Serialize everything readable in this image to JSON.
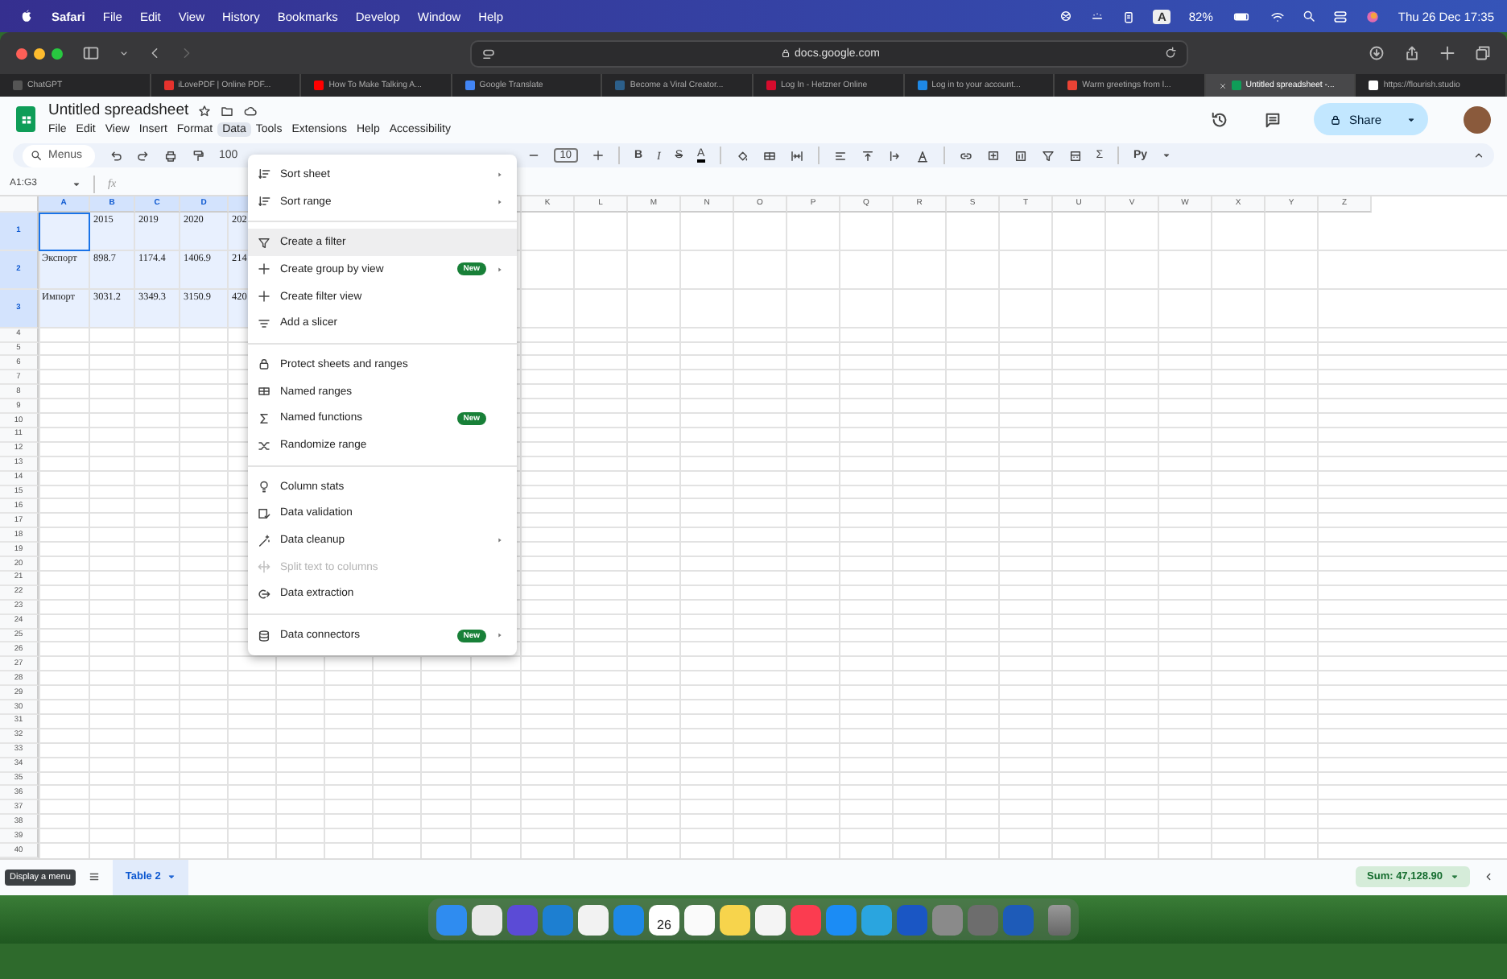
{
  "menubar": {
    "app": "Safari",
    "items": [
      "File",
      "Edit",
      "View",
      "History",
      "Bookmarks",
      "Develop",
      "Window",
      "Help"
    ],
    "input_source": "A",
    "battery": "82%",
    "clock": "Thu 26 Dec  17:35"
  },
  "browser": {
    "address": "docs.google.com",
    "tabs": [
      {
        "title": "ChatGPT",
        "selected": false
      },
      {
        "title": "iLovePDF | Online PDF...",
        "selected": false
      },
      {
        "title": "How To Make Talking A...",
        "selected": false
      },
      {
        "title": "Google Translate",
        "selected": false
      },
      {
        "title": "Become a Viral Creator...",
        "selected": false
      },
      {
        "title": "Log In - Hetzner Online",
        "selected": false
      },
      {
        "title": "Log in to your account...",
        "selected": false
      },
      {
        "title": "Warm greetings from l...",
        "selected": false
      },
      {
        "title": "Untitled spreadsheet -...",
        "selected": true
      },
      {
        "title": "https://flourish.studio",
        "selected": false
      }
    ]
  },
  "doc": {
    "title": "Untitled spreadsheet",
    "share": "Share",
    "menus": [
      {
        "label": "File",
        "selected": false
      },
      {
        "label": "Edit",
        "selected": false
      },
      {
        "label": "View",
        "selected": false
      },
      {
        "label": "Insert",
        "selected": false
      },
      {
        "label": "Format",
        "selected": false
      },
      {
        "label": "Data",
        "selected": true
      },
      {
        "label": "Tools",
        "selected": false
      },
      {
        "label": "Extensions",
        "selected": false
      },
      {
        "label": "Help",
        "selected": false
      },
      {
        "label": "Accessibility",
        "selected": false
      }
    ]
  },
  "toolbar": {
    "search": "Menus",
    "zoom": "100",
    "font_size": "10",
    "bold": "B",
    "italic": "I",
    "strike": "S",
    "text_color": "A",
    "sum": "Σ",
    "input_tool": "Py"
  },
  "formula_bar": {
    "name_box": "A1:G3",
    "fx": "fx"
  },
  "grid": {
    "columns_left": [
      "A",
      "B",
      "C",
      "D"
    ],
    "columns_right": [
      "K",
      "L",
      "M",
      "N",
      "O",
      "P",
      "Q",
      "R",
      "S",
      "T",
      "U",
      "V",
      "W",
      "X",
      "Y",
      "Z"
    ],
    "rows": [
      {
        "header": "1",
        "selected": true,
        "values": [
          "2015",
          "2019",
          "2020",
          "202"
        ]
      },
      {
        "header": "2",
        "selected": true,
        "label": "Экспорт",
        "values": [
          "898.7",
          "1174.4",
          "1406.9",
          "214"
        ]
      },
      {
        "header": "3",
        "selected": true,
        "label": "Импорт",
        "values": [
          "3031.2",
          "3349.3",
          "3150.9",
          "420"
        ]
      }
    ],
    "more_rows": [
      "4",
      "5",
      "6",
      "7",
      "8",
      "9",
      "10",
      "11",
      "12",
      "13",
      "14",
      "15",
      "16",
      "17",
      "18",
      "19",
      "20",
      "21",
      "22",
      "23",
      "24",
      "25",
      "26",
      "27",
      "28",
      "29",
      "30",
      "31",
      "32",
      "33",
      "34",
      "35",
      "36",
      "37",
      "38",
      "39",
      "40"
    ]
  },
  "data_menu": [
    {
      "kind": "item",
      "label": "Sort sheet",
      "submenu": true,
      "disabled": false,
      "highlighted": false
    },
    {
      "kind": "item",
      "label": "Sort range",
      "submenu": true,
      "disabled": false,
      "highlighted": false
    },
    {
      "kind": "divider"
    },
    {
      "kind": "item",
      "label": "Create a filter",
      "submenu": false,
      "disabled": false,
      "highlighted": true
    },
    {
      "kind": "item",
      "label": "Create group by view",
      "badge": "New",
      "submenu": true,
      "disabled": false,
      "highlighted": false
    },
    {
      "kind": "item",
      "label": "Create filter view",
      "submenu": false,
      "disabled": false,
      "highlighted": false
    },
    {
      "kind": "item",
      "label": "Add a slicer",
      "submenu": false,
      "disabled": false,
      "highlighted": false
    },
    {
      "kind": "divider"
    },
    {
      "kind": "item",
      "label": "Protect sheets and ranges",
      "submenu": false,
      "disabled": false,
      "highlighted": false
    },
    {
      "kind": "item",
      "label": "Named ranges",
      "submenu": false,
      "disabled": false,
      "highlighted": false
    },
    {
      "kind": "item",
      "label": "Named functions",
      "badge": "New",
      "submenu": false,
      "disabled": false,
      "highlighted": false
    },
    {
      "kind": "item",
      "label": "Randomize range",
      "submenu": false,
      "disabled": false,
      "highlighted": false
    },
    {
      "kind": "divider"
    },
    {
      "kind": "item",
      "label": "Column stats",
      "submenu": false,
      "disabled": false,
      "highlighted": false
    },
    {
      "kind": "item",
      "label": "Data validation",
      "submenu": false,
      "disabled": false,
      "highlighted": false
    },
    {
      "kind": "item",
      "label": "Data cleanup",
      "submenu": true,
      "disabled": false,
      "highlighted": false
    },
    {
      "kind": "item",
      "label": "Split text to columns",
      "submenu": false,
      "disabled": true,
      "highlighted": false
    },
    {
      "kind": "item",
      "label": "Data extraction",
      "submenu": false,
      "disabled": false,
      "highlighted": false
    },
    {
      "kind": "divider"
    },
    {
      "kind": "item",
      "label": "Data connectors",
      "badge": "New",
      "submenu": true,
      "disabled": false,
      "highlighted": false
    }
  ],
  "sheet_bar": {
    "tooltip": "Display a menu",
    "tabs": [
      {
        "label": "Table 2",
        "selected": true
      }
    ],
    "sum": "Sum: 47,128.90"
  },
  "dock": {
    "calendar_day": "26"
  }
}
